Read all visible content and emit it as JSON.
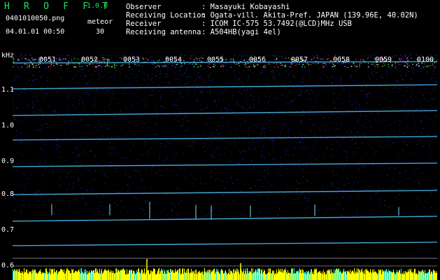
{
  "header": {
    "app_title": "H R O F F T",
    "version": "1.0.0",
    "file_name": "0401010050.png",
    "timestamp": "04.01.01 00:50",
    "meteor_label": "meteor",
    "meteor_count": "30"
  },
  "info": [
    {
      "key": "Observer",
      "value": ": Masayuki Kobayashi"
    },
    {
      "key": "Receiving Location",
      "value": ": Ogata-vill. Akita-Pref. JAPAN (139.96E, 40.02N)"
    },
    {
      "key": "Receiver",
      "value": ": ICOM IC-575 53.7492(@LCD)MHz USB"
    },
    {
      "key": "Receiving antenna",
      "value": ": A504HB(yagi 4el)"
    }
  ],
  "axis": {
    "unit": "kHz",
    "y_ticks": [
      "1.1",
      "1.0",
      "0.9",
      "0.8",
      "0.7",
      "0.6"
    ],
    "time_labels": [
      "0051",
      "0052",
      "0053",
      "0054",
      "0055",
      "0056",
      "0057",
      "0058",
      "0059",
      "0100"
    ]
  },
  "colors": {
    "text_green": "#22e060",
    "text_white": "#ffffff",
    "background": "#000000",
    "echo_yellow": "#ffff00",
    "echo_cyan": "#00ffff"
  }
}
